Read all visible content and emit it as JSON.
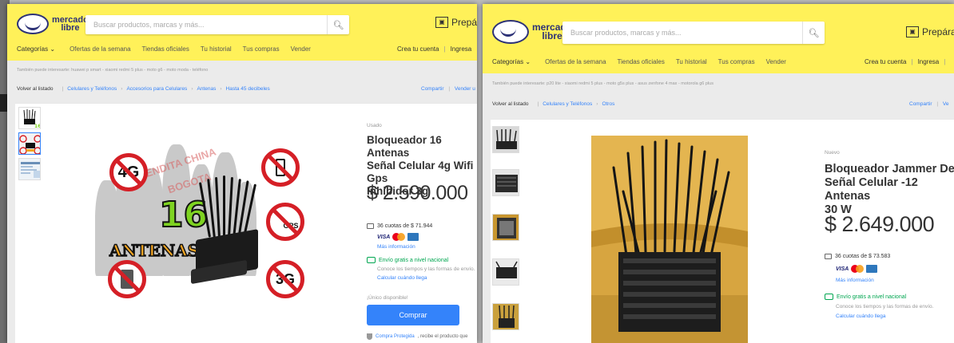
{
  "screenshots": [
    {
      "header": {
        "logo_text_top": "mercado",
        "logo_text_bottom": "libre",
        "search_placeholder": "Buscar productos, marcas y más...",
        "search_icon": "search-icon",
        "promo_text": "Prepár",
        "nav": [
          "Categorías ⌄",
          "Ofertas de la semana",
          "Tiendas oficiales",
          "Tu historial",
          "Tus compras",
          "Vender"
        ],
        "account": {
          "create": "Crea tu cuenta",
          "login": "Ingresa"
        }
      },
      "suggestions": "También puede interesarte: huawei p smart - xiaomi redmi 5 plus - moto g6 - moto moda - teléfono",
      "breadcrumb": {
        "back": "Volver al listado",
        "items": [
          "Celulares y Teléfonos",
          "Accesorios para Celulares",
          "Antenas",
          "Hasta 45 decibeles"
        ]
      },
      "share": {
        "share": "Compartir",
        "sell": "Vender u"
      },
      "product": {
        "condition": "Usado",
        "title_lines": [
          "Bloqueador 16 Antenas",
          "Señal Celular 4g Wifi Gps",
          "Inhibidor 3g"
        ],
        "price": "$ 2.590.000",
        "installments": "36 cuotas de $ 71.944",
        "more_info": "Más información",
        "shipping": "Envío gratis a nivel nacional",
        "shipping_desc": "Conoce los tiempos y las formas de envío.",
        "shipping_link": "Calcular cuándo llega",
        "stock": "¡Único disponible!",
        "buy": "Comprar",
        "protected_link": "Compra Protegida",
        "protected_text": ", recibe el producto que"
      },
      "image": {
        "watermark_1": "TIENDITA CHINA",
        "watermark_2": "BOGOTA",
        "big_number": "16",
        "banner": "ANTENAS",
        "sign_4g": "4G",
        "sign_3g": "3G",
        "sign_gps": "GPS"
      }
    },
    {
      "header": {
        "logo_text_top": "mercado",
        "logo_text_bottom": "libre",
        "search_placeholder": "Buscar productos, marcas y más...",
        "search_icon": "search-icon",
        "promo_text": "Prepára",
        "nav": [
          "Categorías ⌄",
          "Ofertas de la semana",
          "Tiendas oficiales",
          "Tu historial",
          "Tus compras",
          "Vender"
        ],
        "account": {
          "create": "Crea tu cuenta",
          "login": "Ingresa"
        }
      },
      "suggestions": "También puede interesarte: p20 lite - xiaomi redmi 5 plus - moto g5s plus - asus zenfone 4 max - motorola g6 plus",
      "breadcrumb": {
        "back": "Volver al listado",
        "items": [
          "Celulares y Teléfonos",
          "Otros"
        ]
      },
      "share": {
        "share": "Compartir",
        "sell": "Ve"
      },
      "product": {
        "condition": "Nuevo",
        "title_lines": [
          "Bloqueador Jammer De",
          "Señal Celular -12 Antenas",
          "30 W"
        ],
        "price": "$ 2.649.000",
        "installments": "36 cuotas de $ 73.583",
        "more_info": "Más información",
        "shipping": "Envío gratis a nivel nacional",
        "shipping_desc": "Conoce los tiempos y las formas de envío.",
        "shipping_link": "Calcular cuándo llega"
      }
    }
  ],
  "colors": {
    "header_yellow": "#fff159",
    "link_blue": "#3483fa",
    "shipping_green": "#00a650",
    "brand_navy": "#2d3277"
  }
}
